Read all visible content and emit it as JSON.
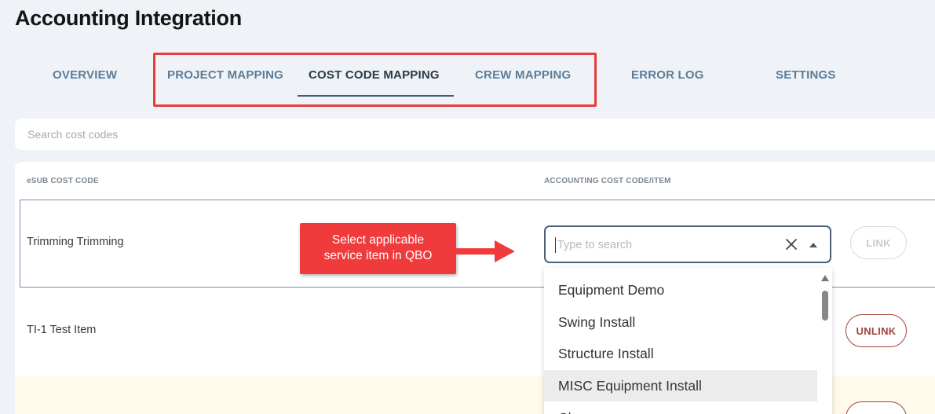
{
  "page": {
    "title": "Accounting Integration"
  },
  "tabs": [
    {
      "label": "OVERVIEW",
      "active": false
    },
    {
      "label": "PROJECT MAPPING",
      "active": false
    },
    {
      "label": "COST CODE MAPPING",
      "active": true
    },
    {
      "label": "CREW MAPPING",
      "active": false
    },
    {
      "label": "ERROR LOG",
      "active": false
    },
    {
      "label": "SETTINGS",
      "active": false
    }
  ],
  "search": {
    "placeholder": "Search cost codes",
    "value": ""
  },
  "table": {
    "headers": {
      "esub_cost_code": "eSUB COST CODE",
      "accounting_item": "ACCOUNTING COST CODE/ITEM"
    },
    "rows": [
      {
        "name": "Trimming Trimming",
        "action": "LINK",
        "selected": true
      },
      {
        "name": "TI-1 Test Item",
        "action": "UNLINK",
        "selected": false
      }
    ]
  },
  "dropdown": {
    "placeholder": "Type to search",
    "value": "",
    "options": [
      "Equipment Demo",
      "Swing Install",
      "Structure Install",
      "MISC Equipment Install",
      "Cleanup"
    ],
    "hovered_option": "MISC Equipment Install"
  },
  "annotation": {
    "line1": "Select applicable",
    "line2": "service item in QBO"
  },
  "colors": {
    "accent": "#3f5d77",
    "tab_inactive": "#5b7c98",
    "highlight_red": "#e63d3d",
    "unlink_red": "#a3433c",
    "callout_red": "#ef3b3b"
  },
  "icons": [
    "clear-icon",
    "dropdown-arrow-icon",
    "scroll-up-icon"
  ]
}
